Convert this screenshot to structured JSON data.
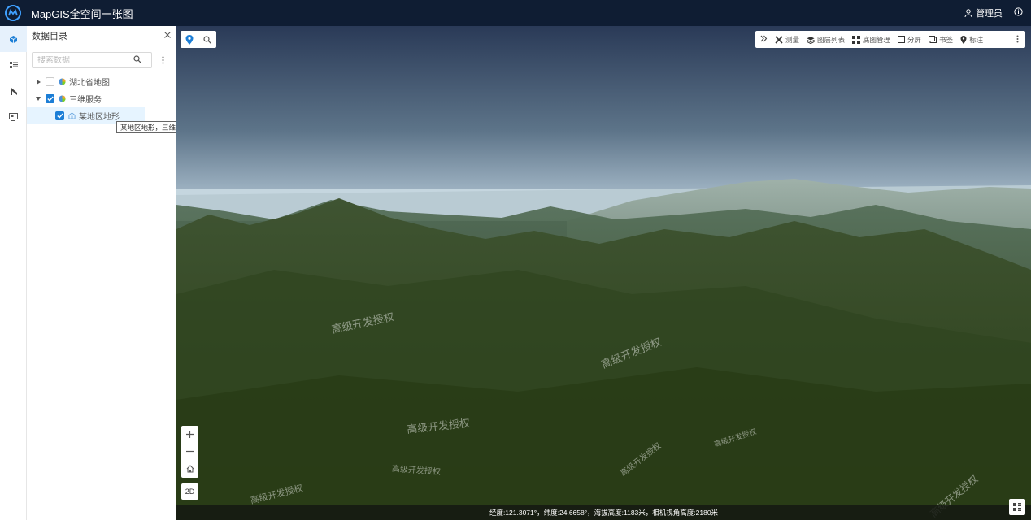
{
  "app": {
    "title": "MapGIS全空间一张图"
  },
  "header": {
    "user_label": "管理员"
  },
  "panel": {
    "title": "数据目录",
    "search_placeholder": "搜索数据",
    "tree": [
      {
        "label": "湖北省地图",
        "checked": false,
        "expanded": false
      },
      {
        "label": "三维服务",
        "checked": true,
        "expanded": true,
        "children": [
          {
            "label": "某地区地形",
            "checked": true
          }
        ]
      }
    ],
    "tooltip": "某地区地形，三维地形服务"
  },
  "toolbar": {
    "items": [
      {
        "label": "测量",
        "icon": "satellite-icon"
      },
      {
        "label": "图层列表",
        "icon": "layers-icon"
      },
      {
        "label": "底图管理",
        "icon": "grid-icon"
      },
      {
        "label": "分屏",
        "icon": "square-icon"
      },
      {
        "label": "书签",
        "icon": "bookmark-icon"
      },
      {
        "label": "标注",
        "icon": "pin-icon"
      }
    ]
  },
  "map": {
    "watermark": "高级开发授权",
    "mode_button": "2D",
    "status": "经度:121.3071°，纬度:24.6658°，海拔高度:1183米，相机视角高度:2180米"
  },
  "colors": {
    "header_bg": "#0f1d33",
    "accent": "#1c7ed6",
    "terrain": "#3b4d2e"
  }
}
